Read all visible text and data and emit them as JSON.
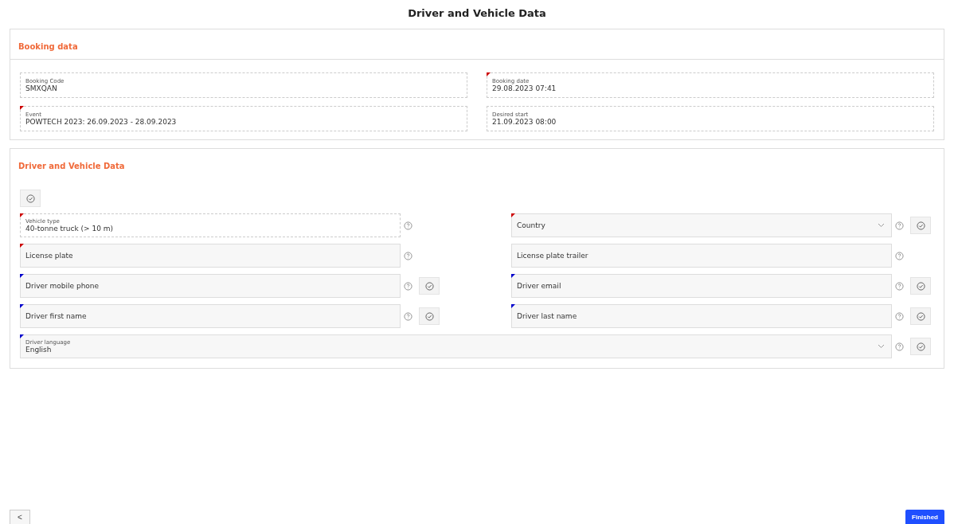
{
  "title": "Driver and Vehicle Data",
  "booking": {
    "heading": "Booking data",
    "fields": [
      {
        "label": "Booking Code",
        "value": "SMXQAN"
      },
      {
        "label": "Booking date",
        "value": "29.08.2023 07:41",
        "color": "#cc0000"
      },
      {
        "label": "Event",
        "value": "POWTECH 2023: 26.09.2023 - 28.09.2023",
        "color": "#cc0000"
      },
      {
        "label": "Desired start",
        "value": "21.09.2023 08:00"
      }
    ]
  },
  "driver": {
    "heading": "Driver and Vehicle Data",
    "fields": [
      {
        "kind": "readonly",
        "label": "Vehicle type",
        "value": "40-tonne truck (> 10 m)",
        "color": "#cc0000",
        "verify": false,
        "wide": false
      },
      {
        "kind": "select",
        "placeholder": "Country",
        "color": "#cc0000",
        "verify": true,
        "wide": false
      },
      {
        "kind": "input",
        "placeholder": "License plate",
        "color": "#cc0000",
        "verify": false,
        "wide": false
      },
      {
        "kind": "input",
        "placeholder": "License plate trailer",
        "verify": false,
        "wide": false
      },
      {
        "kind": "input",
        "placeholder": "Driver mobile phone",
        "color": "#0000cc",
        "verify": true,
        "wide": false
      },
      {
        "kind": "input",
        "placeholder": "Driver email",
        "color": "#0000cc",
        "verify": true,
        "wide": false
      },
      {
        "kind": "input",
        "placeholder": "Driver first name",
        "color": "#0000cc",
        "verify": true,
        "wide": false
      },
      {
        "kind": "input",
        "placeholder": "Driver last name",
        "color": "#0000cc",
        "verify": true,
        "wide": false
      },
      {
        "kind": "select",
        "label": "Driver language",
        "value": "English",
        "color": "#0000cc",
        "verify": true,
        "wide": true
      }
    ]
  },
  "buttons": {
    "back": "<",
    "finish": "Finished"
  }
}
